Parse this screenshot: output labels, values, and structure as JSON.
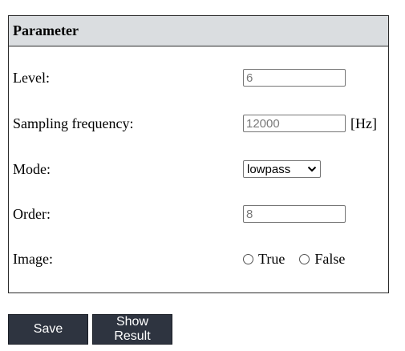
{
  "panel": {
    "title": "Parameter"
  },
  "fields": {
    "level": {
      "label": "Level:",
      "value": "6"
    },
    "sampling_frequency": {
      "label": "Sampling frequency:",
      "value": "12000",
      "unit": "[Hz]"
    },
    "mode": {
      "label": "Mode:",
      "selected": "lowpass"
    },
    "order": {
      "label": "Order:",
      "value": "8"
    },
    "image": {
      "label": "Image:",
      "options": [
        {
          "label": "True",
          "checked": false
        },
        {
          "label": "False",
          "checked": false
        }
      ]
    }
  },
  "buttons": {
    "save_label": "Save",
    "show_result_label": "Show Result"
  },
  "colors": {
    "header_bg": "#dadde0",
    "button_bg": "#2e3440",
    "input_text": "#7a7a7a"
  }
}
